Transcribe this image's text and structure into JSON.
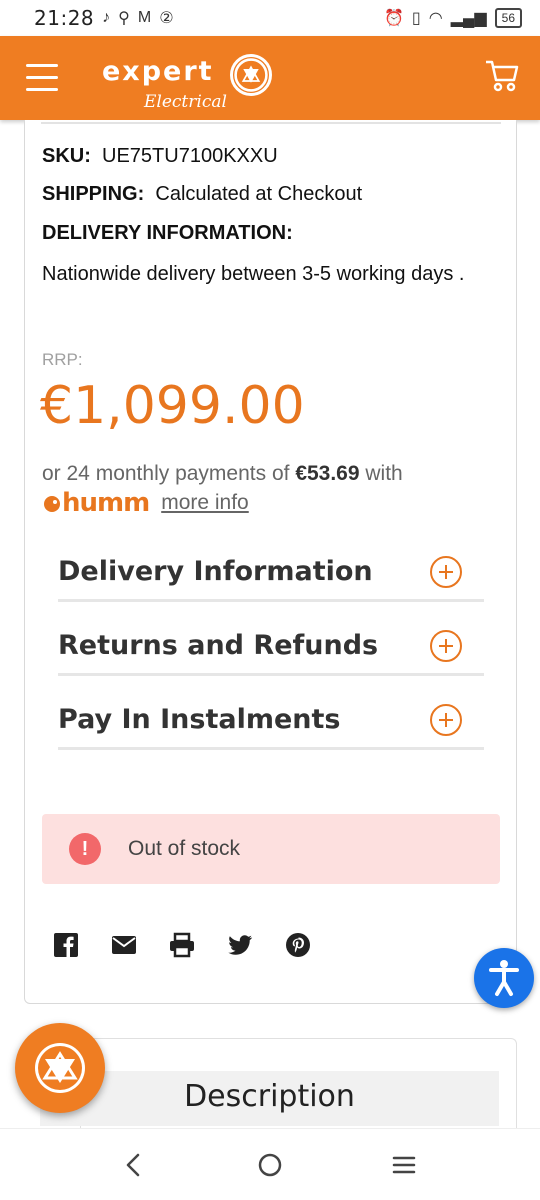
{
  "statusbar": {
    "time": "21:28",
    "battery": "56"
  },
  "header": {
    "brand": "expert",
    "brand_sub": "Electrical"
  },
  "product": {
    "sku_label": "SKU:",
    "sku_value": "UE75TU7100KXXU",
    "shipping_label": "SHIPPING:",
    "shipping_value": "Calculated at Checkout",
    "delivery_heading": "DELIVERY INFORMATION:",
    "delivery_text": "Nationwide delivery between 3-5 working days .",
    "rrp_label": "RRP:",
    "price": "€1,099.00",
    "monthly_prefix": "or 24 monthly payments of",
    "monthly_amount": "€53.69",
    "monthly_suffix": "with",
    "humm_logo": "humm",
    "more_info": "more info"
  },
  "accordion": [
    {
      "label": "Delivery Information"
    },
    {
      "label": "Returns and Refunds"
    },
    {
      "label": "Pay In Instalments"
    }
  ],
  "stock": {
    "alert_symbol": "!",
    "status": "Out of stock"
  },
  "share_icons": [
    "facebook-icon",
    "email-icon",
    "print-icon",
    "twitter-icon",
    "pinterest-icon"
  ],
  "description": {
    "title": "Description"
  },
  "colors": {
    "brand_orange": "#ef7d22",
    "price_orange": "#e8761f",
    "alert_bg": "#fde0df",
    "accessibility_blue": "#1a73e8"
  }
}
